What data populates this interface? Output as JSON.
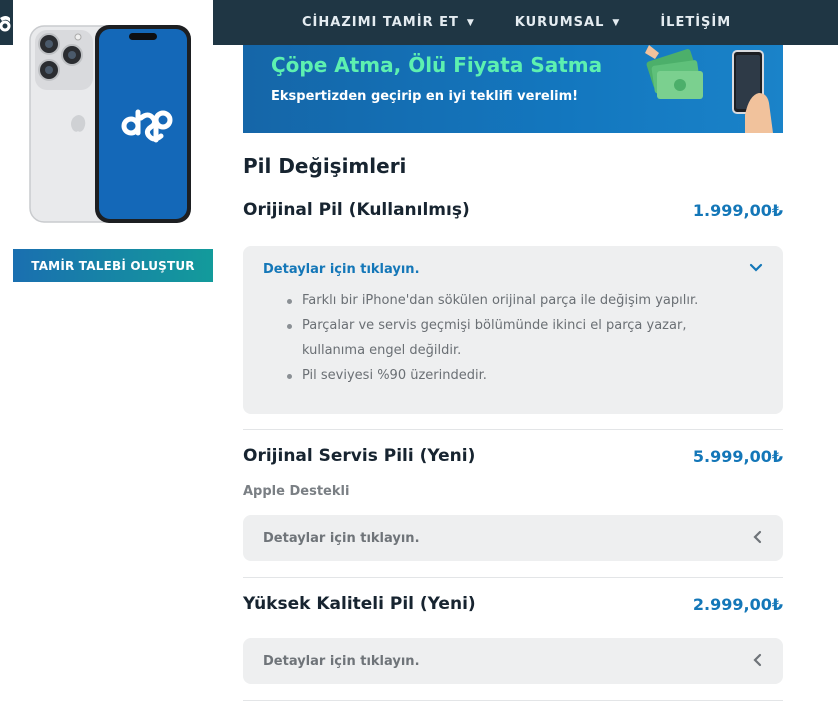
{
  "nav": {
    "items": [
      {
        "label": "CİHAZIMI TAMİR ET",
        "has_caret": true,
        "caret_icon": "chevron-down-icon"
      },
      {
        "label": "KURUMSAL",
        "has_caret": true,
        "caret_icon": "chevron-down-icon"
      },
      {
        "label": "İLETİŞİM",
        "has_caret": false
      }
    ]
  },
  "product": {
    "image": "iphone-silver-product-image",
    "screen_logo": "dsp-logo"
  },
  "repair_button": {
    "label": "TAMİR TALEBİ OLUŞTUR"
  },
  "banner": {
    "title": "Çöpe Atma, Ölü Fiyata Satma",
    "subtitle": "Ekspertizden geçirip en iyi teklifi verelim!"
  },
  "section": {
    "title": "Pil Değişimleri"
  },
  "items": [
    {
      "name": "Orijinal Pil (Kullanılmış)",
      "price": "1.999,00₺",
      "details_label": "Detaylar için tıklayın.",
      "expanded": true,
      "details": [
        "Farklı bir iPhone'dan sökülen orijinal parça ile değişim yapılır.",
        "Parçalar ve servis geçmişi bölümünde ikinci el parça yazar,",
        "kullanıma engel değildir.",
        "Pil seviyesi %90 üzerindedir."
      ]
    },
    {
      "name": "Orijinal Servis Pili (Yeni)",
      "price": "5.999,00₺",
      "subtitle": "Apple Destekli",
      "details_label": "Detaylar için tıklayın.",
      "expanded": false
    },
    {
      "name": "Yüksek Kaliteli Pil (Yeni)",
      "price": "2.999,00₺",
      "details_label": "Detaylar için tıklayın.",
      "expanded": false
    }
  ],
  "colors": {
    "nav_bg": "#1f3644",
    "accent_blue": "#1477b8",
    "banner_green": "#5df0b0",
    "panel_bg": "#eeeff0"
  }
}
